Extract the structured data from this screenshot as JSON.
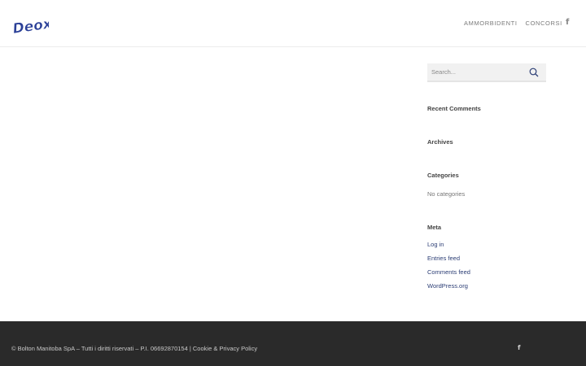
{
  "brand": {
    "logo_text": "Deox",
    "logo_color": "#2a3f97"
  },
  "nav": {
    "items": [
      {
        "label": "AMMORBIDENTI"
      },
      {
        "label": "CONCORSI"
      }
    ],
    "social_icon": "facebook-icon"
  },
  "search": {
    "placeholder": "Search...",
    "icon": "search-icon"
  },
  "widgets": {
    "recent_comments_title": "Recent Comments",
    "archives_title": "Archives",
    "categories_title": "Categories",
    "categories_empty": "No categories",
    "meta_title": "Meta",
    "meta_links": [
      "Log in",
      "Entries feed",
      "Comments feed",
      "WordPress.org"
    ]
  },
  "footer": {
    "copyright": "© Bolton Manitoba SpA – Tutti i diritti riservati – P.I. 06692870154 | ",
    "policy_link": "Cookie & Privacy Policy",
    "social_icon": "facebook-icon",
    "background": "#2a2a2a"
  }
}
